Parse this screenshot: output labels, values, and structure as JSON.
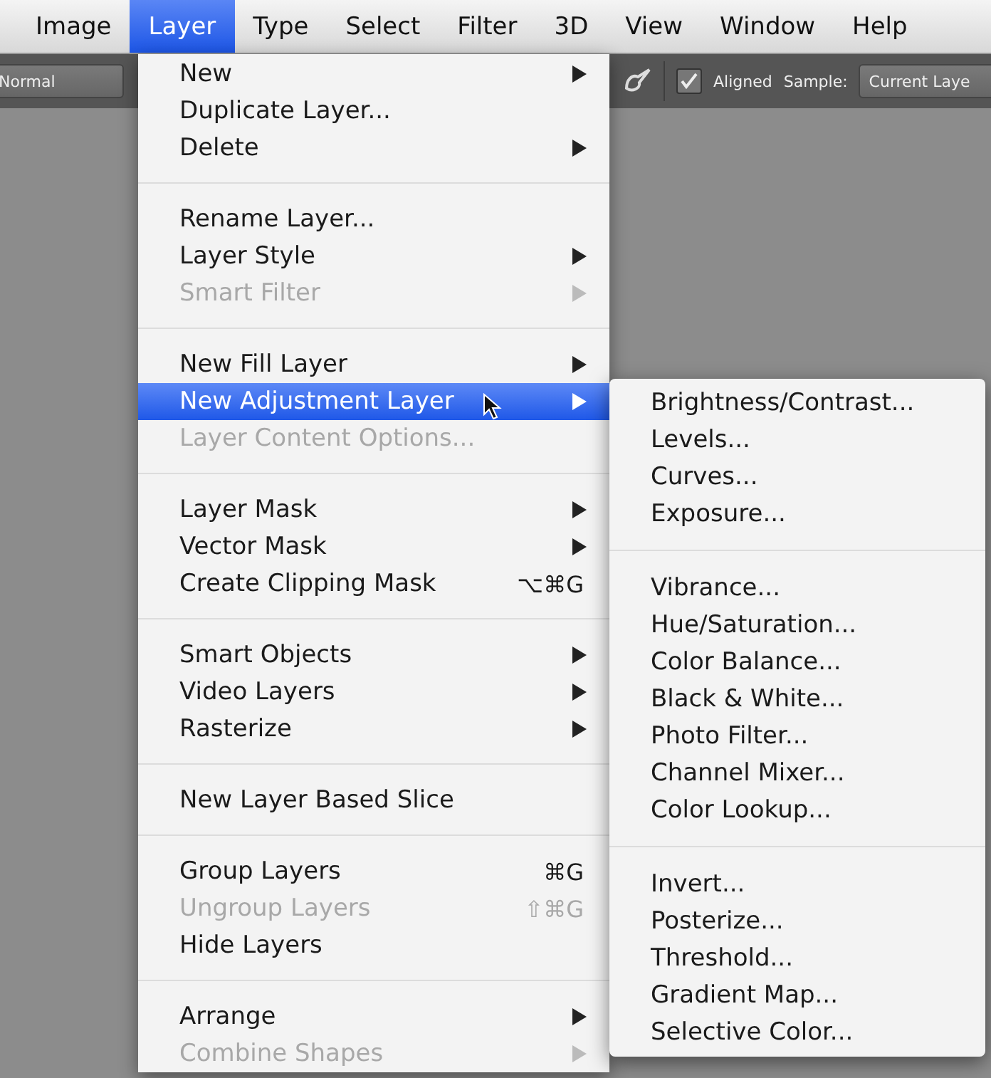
{
  "menubar": [
    {
      "label": "Image",
      "selected": false
    },
    {
      "label": "Layer",
      "selected": true
    },
    {
      "label": "Type",
      "selected": false
    },
    {
      "label": "Select",
      "selected": false
    },
    {
      "label": "Filter",
      "selected": false
    },
    {
      "label": "3D",
      "selected": false
    },
    {
      "label": "View",
      "selected": false
    },
    {
      "label": "Window",
      "selected": false
    },
    {
      "label": "Help",
      "selected": false
    }
  ],
  "options_bar": {
    "blend_mode": "Normal",
    "aligned": {
      "label": "Aligned",
      "checked": true
    },
    "sample_label": "Sample:",
    "sample_value": "Current Laye"
  },
  "layer_menu": {
    "groups": [
      {
        "items": [
          {
            "label": "New",
            "submenu": true,
            "disabled": false,
            "selected": false
          },
          {
            "label": "Duplicate Layer...",
            "submenu": false,
            "disabled": false,
            "selected": false
          },
          {
            "label": "Delete",
            "submenu": true,
            "disabled": false,
            "selected": false
          }
        ]
      },
      {
        "items": [
          {
            "label": "Rename Layer...",
            "submenu": false,
            "disabled": false,
            "selected": false
          },
          {
            "label": "Layer Style",
            "submenu": true,
            "disabled": false,
            "selected": false
          },
          {
            "label": "Smart Filter",
            "submenu": true,
            "disabled": true,
            "selected": false
          }
        ]
      },
      {
        "items": [
          {
            "label": "New Fill Layer",
            "submenu": true,
            "disabled": false,
            "selected": false
          },
          {
            "label": "New Adjustment Layer",
            "submenu": true,
            "disabled": false,
            "selected": true
          },
          {
            "label": "Layer Content Options...",
            "submenu": false,
            "disabled": true,
            "selected": false
          }
        ]
      },
      {
        "items": [
          {
            "label": "Layer Mask",
            "submenu": true,
            "disabled": false,
            "selected": false
          },
          {
            "label": "Vector Mask",
            "submenu": true,
            "disabled": false,
            "selected": false
          },
          {
            "label": "Create Clipping Mask",
            "shortcut": "⌥⌘G",
            "submenu": false,
            "disabled": false,
            "selected": false
          }
        ]
      },
      {
        "items": [
          {
            "label": "Smart Objects",
            "submenu": true,
            "disabled": false,
            "selected": false
          },
          {
            "label": "Video Layers",
            "submenu": true,
            "disabled": false,
            "selected": false
          },
          {
            "label": "Rasterize",
            "submenu": true,
            "disabled": false,
            "selected": false
          }
        ]
      },
      {
        "items": [
          {
            "label": "New Layer Based Slice",
            "submenu": false,
            "disabled": false,
            "selected": false
          }
        ]
      },
      {
        "items": [
          {
            "label": "Group Layers",
            "shortcut": "⌘G",
            "submenu": false,
            "disabled": false,
            "selected": false
          },
          {
            "label": "Ungroup Layers",
            "shortcut": "⇧⌘G",
            "submenu": false,
            "disabled": true,
            "selected": false
          },
          {
            "label": "Hide Layers",
            "submenu": false,
            "disabled": false,
            "selected": false
          }
        ]
      },
      {
        "items": [
          {
            "label": "Arrange",
            "submenu": true,
            "disabled": false,
            "selected": false
          },
          {
            "label": "Combine Shapes",
            "submenu": true,
            "disabled": true,
            "selected": false
          }
        ]
      }
    ]
  },
  "adjustment_submenu": {
    "groups": [
      {
        "items": [
          "Brightness/Contrast...",
          "Levels...",
          "Curves...",
          "Exposure..."
        ]
      },
      {
        "items": [
          "Vibrance...",
          "Hue/Saturation...",
          "Color Balance...",
          "Black & White...",
          "Photo Filter...",
          "Channel Mixer...",
          "Color Lookup..."
        ]
      },
      {
        "items": [
          "Invert...",
          "Posterize...",
          "Threshold...",
          "Gradient Map...",
          "Selective Color..."
        ]
      }
    ]
  }
}
